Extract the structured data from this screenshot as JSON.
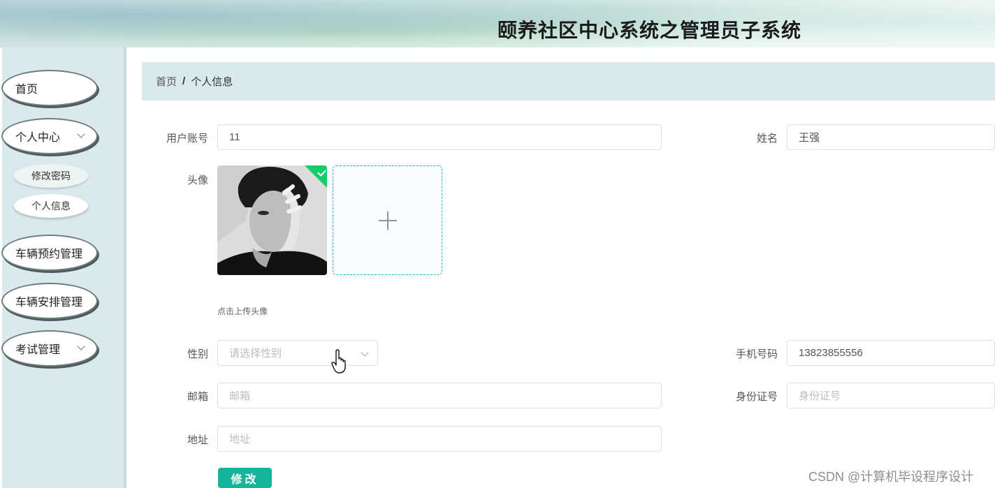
{
  "header": {
    "title": "颐养社区中心系统之管理员子系统"
  },
  "sidebar": {
    "items": [
      {
        "label": "首页",
        "expandable": false
      },
      {
        "label": "个人中心",
        "expandable": true,
        "children": [
          {
            "label": "修改密码"
          },
          {
            "label": "个人信息",
            "active": true
          }
        ]
      },
      {
        "label": "车辆预约管理",
        "expandable": false
      },
      {
        "label": "车辆安排管理",
        "expandable": false
      },
      {
        "label": "考试管理",
        "expandable": true
      }
    ]
  },
  "breadcrumb": {
    "home": "首页",
    "separator": "/",
    "current": "个人信息"
  },
  "form": {
    "account": {
      "label": "用户账号",
      "value": "11"
    },
    "name": {
      "label": "姓名",
      "value": "王强"
    },
    "avatar": {
      "label": "头像",
      "upload_hint": "点击上传头像"
    },
    "gender": {
      "label": "性别",
      "placeholder": "请选择性别"
    },
    "phone": {
      "label": "手机号码",
      "value": "13823855556"
    },
    "email": {
      "label": "邮箱",
      "placeholder": "邮箱"
    },
    "id_card": {
      "label": "身份证号",
      "placeholder": "身份证号"
    },
    "address": {
      "label": "地址",
      "placeholder": "地址"
    },
    "submit_label": "修改"
  },
  "watermark": "CSDN @计算机毕设程序设计",
  "colors": {
    "accent": "#15b49b",
    "sidebar_bg": "#d9e9ec",
    "success": "#13ce66"
  },
  "icons": {
    "plus": "plus-icon",
    "check": "check-icon",
    "chevron": "chevron-down-icon",
    "cursor": "hand-pointer-icon"
  }
}
